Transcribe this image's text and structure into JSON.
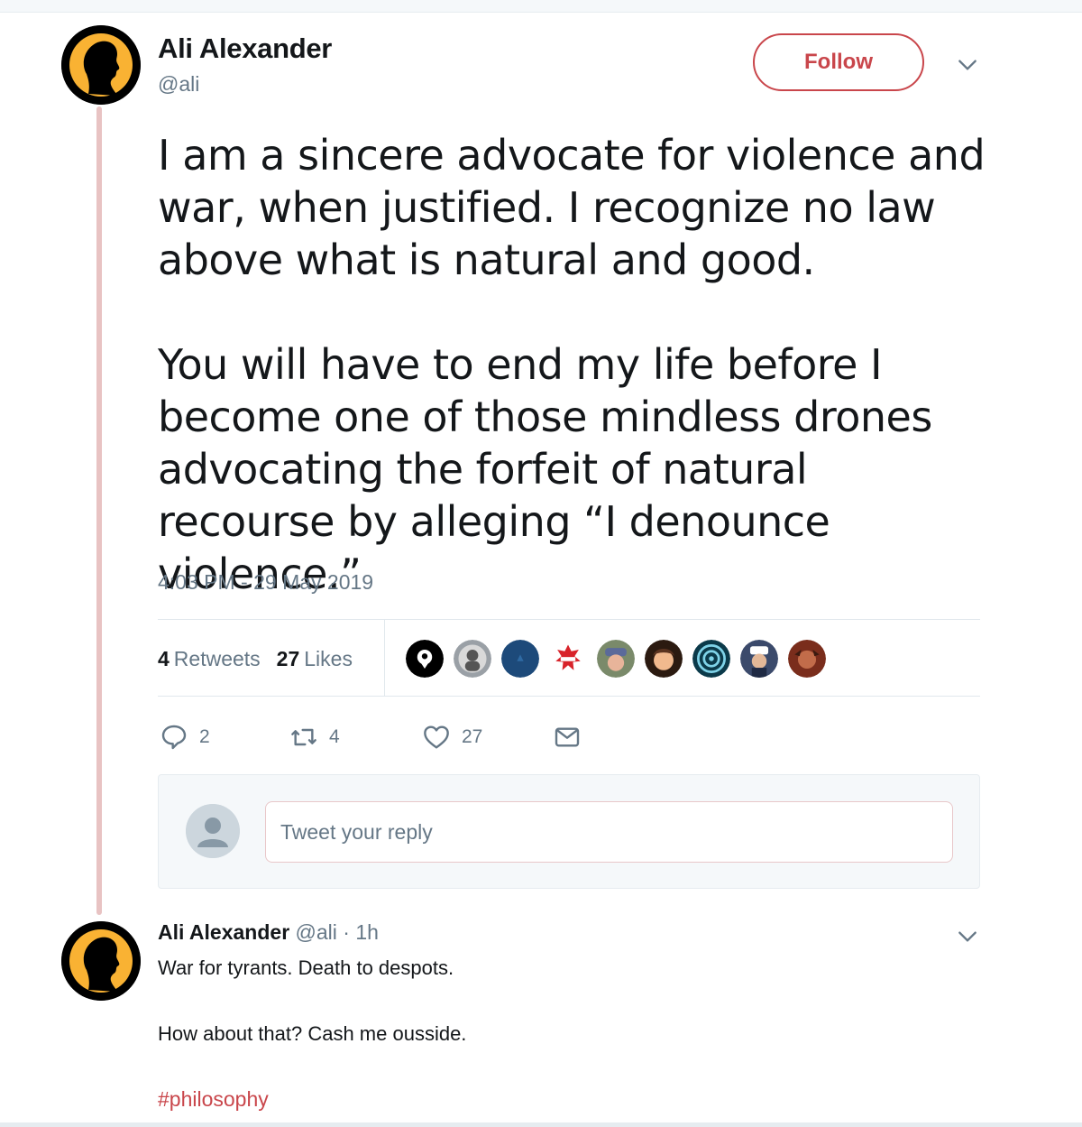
{
  "main_tweet": {
    "author_name": "Ali Alexander",
    "author_handle": "@ali",
    "follow_label": "Follow",
    "text_paragraphs": [
      "I am a sincere advocate for violence and war, when justified. I recognize no law above what is natural and good.",
      "You will have to end my life before I become one of those mindless drones advocating the forfeit of natural recourse by alleging “I denounce violence.”"
    ],
    "timestamp": "4:03 PM - 29 May 2019",
    "stats": {
      "retweets_count": "4",
      "retweets_label": "Retweets",
      "likes_count": "27",
      "likes_label": "Likes"
    },
    "liker_avatars": [
      "liker-1",
      "liker-2",
      "liker-3",
      "liker-4",
      "liker-5",
      "liker-6",
      "liker-7",
      "liker-8",
      "liker-9"
    ],
    "actions": {
      "reply_count": "2",
      "retweet_count": "4",
      "like_count": "27"
    },
    "icons": [
      "chat-bubble-icon",
      "retweet-icon",
      "heart-icon",
      "envelope-icon",
      "chevron-down-icon"
    ]
  },
  "reply_box": {
    "placeholder": "Tweet your reply"
  },
  "reply_tweet": {
    "author_name": "Ali Alexander",
    "meta": "@ali · 1h",
    "line1": "War for tyrants. Death to despots.",
    "line2": "How about that? Cash me ousside.",
    "hashtag": "#philosophy"
  },
  "colors": {
    "accent": "#c9464b",
    "secondary_text": "#657786",
    "thread_line": "#e8c3c3",
    "avatar_bg": "#000000",
    "avatar_fg": "#f9b233"
  }
}
